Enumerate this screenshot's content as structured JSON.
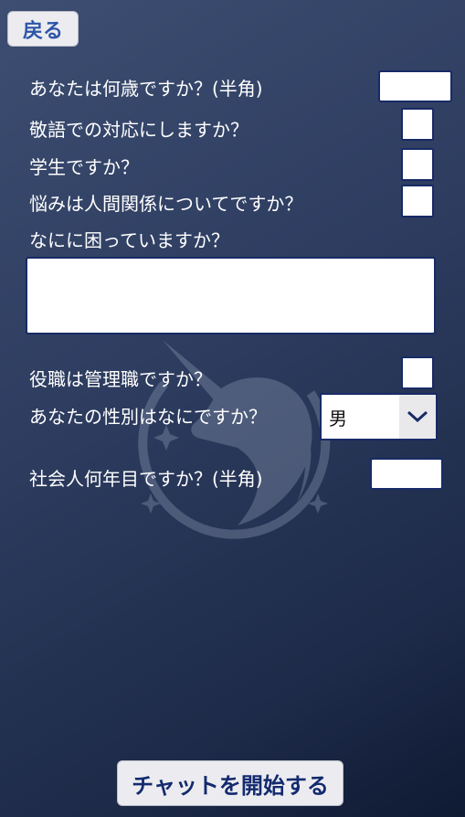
{
  "header": {
    "back_label": "戻る"
  },
  "form": {
    "age_label": "あなたは何歳ですか？(半角)",
    "age_value": "",
    "keigo_label": "敬語での対応にしますか？",
    "student_label": "学生ですか？",
    "relationship_label": "悩みは人間関係についてですか？",
    "trouble_label": "なにに困っていますか？",
    "trouble_value": "",
    "manager_label": "役職は管理職ですか？",
    "gender_label": "あなたの性別はなにですか？",
    "gender_selected": "男",
    "years_label": "社会人何年目ですか？(半角)",
    "years_value": ""
  },
  "footer": {
    "start_label": "チャットを開始する"
  },
  "background": {
    "logo": "unicorn-emblem"
  },
  "colors": {
    "background_top": "#3d4e72",
    "background_bottom": "#0f1a33",
    "field_border": "#182a66",
    "back_text": "#2d55a8",
    "start_text": "#132a6e"
  }
}
